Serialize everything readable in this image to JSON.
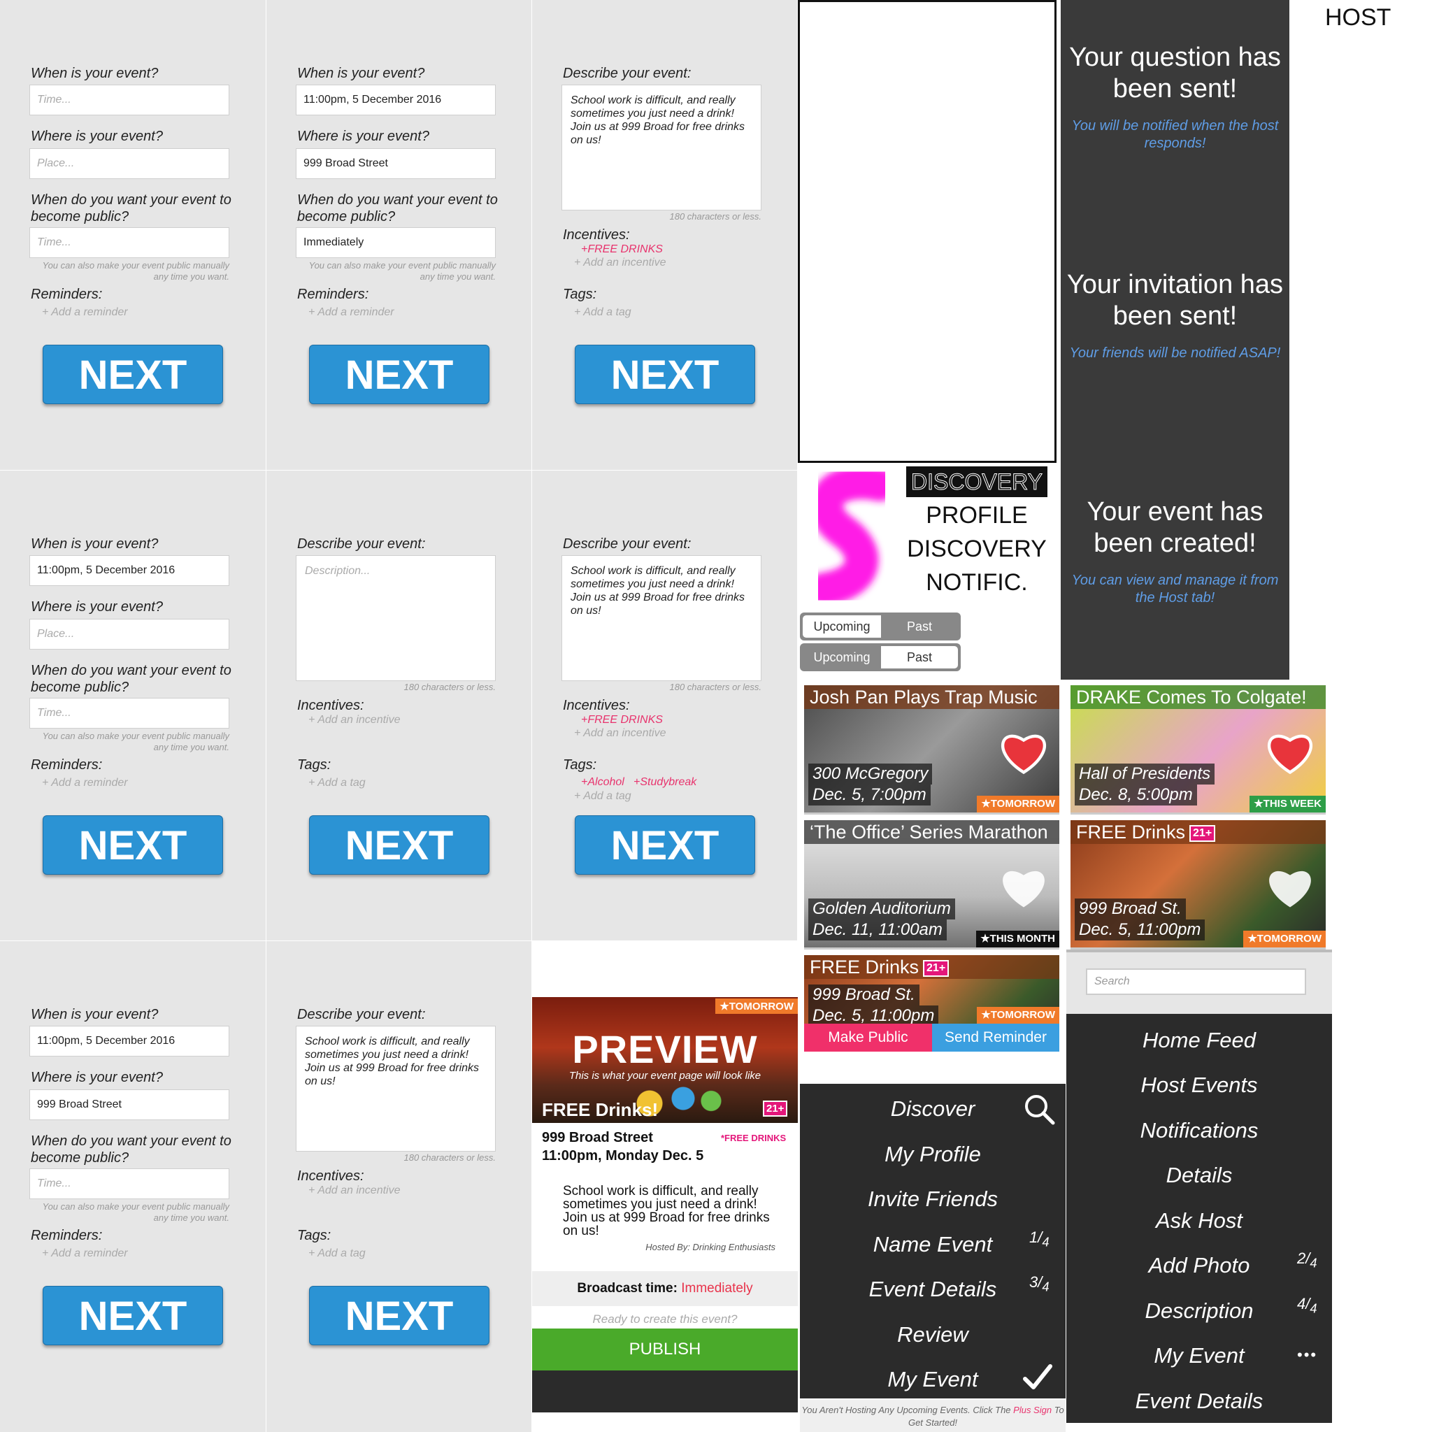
{
  "form": {
    "q_when": "When is your event?",
    "q_where": "Where is your event?",
    "q_public": "When do you want your event to become public?",
    "q_reminders": "Reminders:",
    "q_describe": "Describe your event:",
    "q_incentives": "Incentives:",
    "q_tags": "Tags:",
    "ph_time": "Time...",
    "ph_place": "Place...",
    "ph_description": "Description...",
    "val_time": "11:00pm, 5 December 2016",
    "val_place": "999 Broad Street",
    "val_public": "Immediately",
    "val_description": "School work is difficult, and really sometimes you just need a drink! Join us at 999 Broad for free drinks on us!",
    "public_hint": "You can also make your event public manually any time you want.",
    "chars_hint": "180 characters or less.",
    "add_reminder": "+ Add a reminder",
    "add_incentive": "+ Add an incentive",
    "add_tag": "+ Add a tag",
    "incentive_free_drinks": "+FREE DRINKS",
    "tag_alcohol": "+Alcohol",
    "tag_studybreak": "+Studybreak",
    "next_label": "NEXT"
  },
  "host_label": "HOST",
  "confirmations": [
    {
      "title": "Your question has been sent!",
      "sub": "You will be notified when the host responds!"
    },
    {
      "title": "Your invitation has been sent!",
      "sub": "Your friends will be notified ASAP!"
    },
    {
      "title": "Your event has been created!",
      "sub": "You can view and manage it from the Host tab!"
    }
  ],
  "discovery": {
    "logo_text": "DISCOVERY",
    "line1": "PROFILE",
    "line2": "DISCOVERY",
    "line3": "NOTIFIC."
  },
  "toggle": {
    "upcoming": "Upcoming",
    "past": "Past"
  },
  "cards": [
    {
      "title": "Josh Pan Plays Trap Music",
      "place": "300 McGregory",
      "time": "Dec. 5, 7:00pm",
      "tag": "★TOMORROW",
      "tag_color": "#f07a2a",
      "liked": true
    },
    {
      "title": "DRAKE Comes To Colgate!",
      "place": "Hall of Presidents",
      "time": "Dec. 8, 5:00pm",
      "tag": "★THIS WEEK",
      "tag_color": "#2e9e48",
      "liked": true
    },
    {
      "title": "‘The Office’ Series Marathon",
      "place": "Golden Auditorium",
      "time": "Dec. 11, 11:00am",
      "tag": "★THIS MONTH",
      "tag_color": "#111111",
      "liked": false
    },
    {
      "title": "FREE Drinks",
      "badge": "21+",
      "place": "999 Broad St.",
      "time": "Dec. 5, 11:00pm",
      "tag": "★TOMORROW",
      "tag_color": "#f07a2a",
      "liked": false
    },
    {
      "title": "FREE Drinks",
      "badge": "21+",
      "place": "999 Broad St.",
      "time": "Dec. 5, 11:00pm",
      "tag": "★TOMORROW",
      "tag_color": "#f07a2a",
      "liked": false
    }
  ],
  "host_actions": {
    "make_public": "Make Public",
    "send_reminder": "Send Reminder"
  },
  "preview": {
    "tag": "★TOMORROW",
    "title": "PREVIEW",
    "subtitle": "This is what your event page will look like",
    "event_title": "FREE Drinks!",
    "badge": "21+",
    "address": "999 Broad Street",
    "incentive": "*FREE DRINKS",
    "datetime": "11:00pm, Monday Dec. 5",
    "description": "School work is difficult, and really sometimes you just need a drink! Join us at 999 Broad for free drinks on us!",
    "hosted_by": "Hosted By: Drinking Enthusiasts",
    "broadcast_label": "Broadcast time:",
    "broadcast_value": "Immediately",
    "ready": "Ready to create this event?",
    "publish": "PUBLISH"
  },
  "search": {
    "placeholder": "Search"
  },
  "menu_left": [
    {
      "label": "Discover",
      "extra": "search"
    },
    {
      "label": "My Profile",
      "extra": ""
    },
    {
      "label": "Invite Friends",
      "extra": ""
    },
    {
      "label": "Name Event",
      "extra": "1/4",
      "num": "1",
      "den": "4"
    },
    {
      "label": "Event Details",
      "extra": "3/4",
      "num": "3",
      "den": "4"
    },
    {
      "label": "Review",
      "extra": ""
    },
    {
      "label": "My Event",
      "extra": "check"
    }
  ],
  "menu_left_footer": {
    "pre": "You Aren't Hosting Any Upcoming Events. Click The ",
    "link": "Plus Sign",
    "post": " To Get Started!"
  },
  "menu_right": [
    {
      "label": "Home Feed",
      "extra": ""
    },
    {
      "label": "Host Events",
      "extra": ""
    },
    {
      "label": "Notifications",
      "extra": ""
    },
    {
      "label": "Details",
      "extra": ""
    },
    {
      "label": "Ask Host",
      "extra": ""
    },
    {
      "label": "Add Photo",
      "extra": "2/4",
      "num": "2",
      "den": "4"
    },
    {
      "label": "Description",
      "extra": "4/4",
      "num": "4",
      "den": "4"
    },
    {
      "label": "My Event",
      "extra": "dots",
      "dots": "•••"
    },
    {
      "label": "Event Details",
      "extra": ""
    }
  ],
  "colors": {
    "next_blue": "#2b93d4",
    "dark_panel": "#3a3a3a",
    "accent_pink": "#e8336d",
    "publish_green": "#4aaa2a",
    "confirm_blue": "#5f9de6"
  }
}
